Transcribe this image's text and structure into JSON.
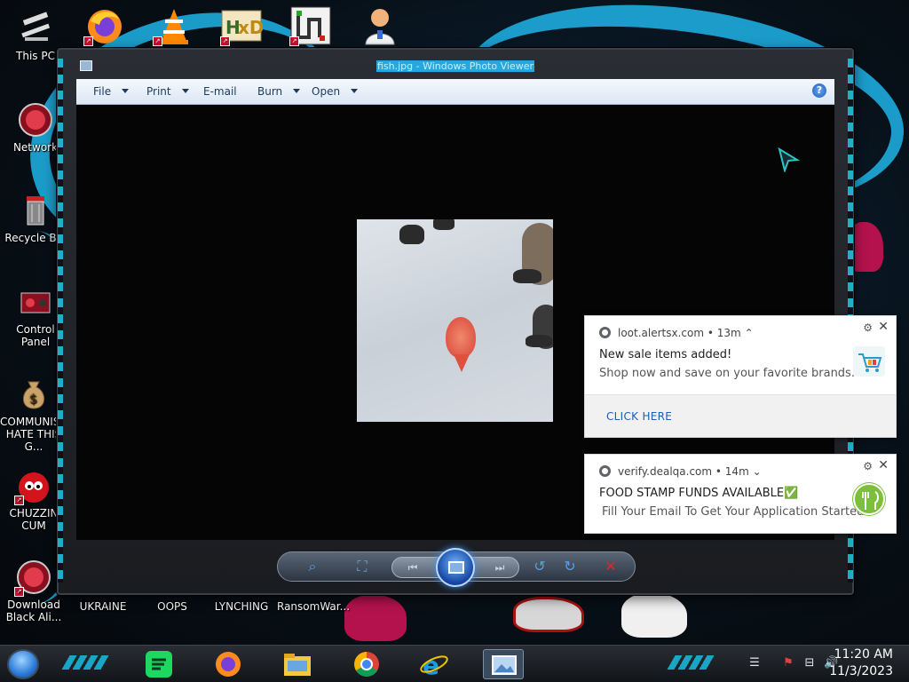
{
  "desktop": {
    "left_icons": [
      {
        "label": "This PC"
      },
      {
        "label": "Network"
      },
      {
        "label": "Recycle Bin"
      },
      {
        "label": "Control Panel"
      },
      {
        "label": "COMMUNISTS HATE THIS G..."
      },
      {
        "label": "CHUZZIN CUM"
      },
      {
        "label": "Download Black Ali..."
      }
    ],
    "bottom_icons": [
      {
        "label": "UKRAINE"
      },
      {
        "label": "OOPS"
      },
      {
        "label": "LYNCHING"
      },
      {
        "label": "RansomWar..."
      }
    ],
    "top_icons": [
      {
        "name": "firefox-icon"
      },
      {
        "name": "vlc-icon"
      },
      {
        "name": "hxd-icon"
      },
      {
        "name": "maze-app-icon"
      },
      {
        "name": "doctor-icon"
      }
    ]
  },
  "viewer": {
    "title": "fish.jpg - Windows Photo Viewer",
    "menu": {
      "file": "File",
      "print": "Print",
      "email": "E-mail",
      "burn": "Burn",
      "open": "Open"
    },
    "help_glyph": "?"
  },
  "notifications": [
    {
      "source": "loot.alertsx.com",
      "age": "13m",
      "title": "New sale items added!",
      "message": "Shop now and save on your favorite brands.",
      "action": "CLICK HERE"
    },
    {
      "source": "verify.dealqa.com",
      "age": "14m",
      "title": "FOOD STAMP FUNDS AVAILABLE✅",
      "message": "Fill Your Email To Get Your Application Started..."
    }
  ],
  "taskbar": {
    "apps": [
      "spotify-icon",
      "firefox-icon",
      "file-explorer-icon",
      "chrome-icon",
      "internet-explorer-icon",
      "photo-viewer-icon"
    ],
    "clock": {
      "time": "11:20 AM",
      "date": "11/3/2023"
    }
  },
  "colors": {
    "accent_cyan": "#1fd0f0",
    "link_blue": "#1a5fb4",
    "delete_red": "#e0242a"
  }
}
